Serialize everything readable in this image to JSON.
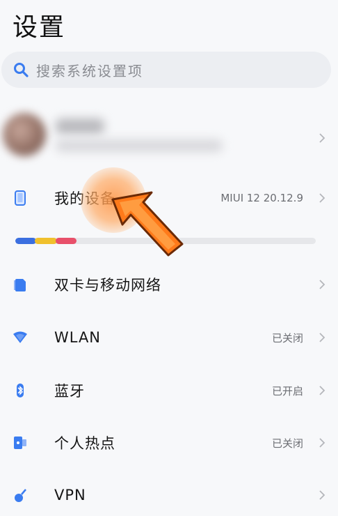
{
  "page": {
    "title": "设置"
  },
  "search": {
    "placeholder": "搜索系统设置项"
  },
  "rows": {
    "my_device": {
      "label": "我的设备",
      "value": "MIUI 12 20.12.9"
    },
    "dual_sim": {
      "label": "双卡与移动网络"
    },
    "wlan": {
      "label": "WLAN",
      "value": "已关闭"
    },
    "bluetooth": {
      "label": "蓝牙",
      "value": "已开启"
    },
    "hotspot": {
      "label": "个人热点",
      "value": "已关闭"
    },
    "vpn": {
      "label": "VPN"
    }
  },
  "storage": {
    "segments": [
      {
        "color": "#3b6fe0"
      },
      {
        "color": "#f0c02c"
      },
      {
        "color": "#e8506a"
      }
    ]
  },
  "colors": {
    "accent": "#3a7cf0",
    "annotation": "#ff7a1a"
  },
  "icons": {
    "search": "search-icon",
    "device": "phone-icon",
    "sim": "sim-card-icon",
    "wlan": "wifi-icon",
    "bluetooth": "bluetooth-icon",
    "hotspot": "hotspot-icon",
    "vpn": "vpn-icon",
    "chevron": "chevron-right-icon"
  }
}
